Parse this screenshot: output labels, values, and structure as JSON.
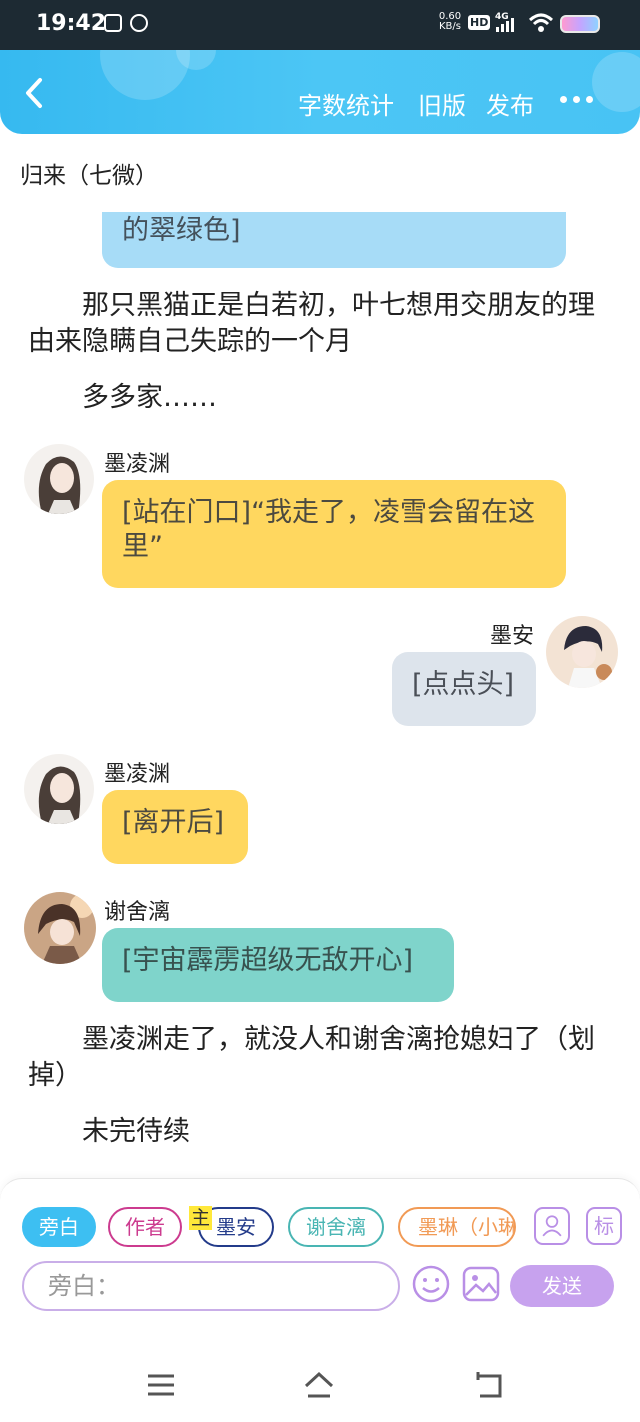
{
  "status": {
    "time": "19:42",
    "net_speed_value": "0.60",
    "net_speed_unit": "KB/s",
    "hd": "HD",
    "network": "4G"
  },
  "header": {
    "word_count": "字数统计",
    "old_version": "旧版",
    "publish": "发布"
  },
  "chapter_title": "归来（七微）",
  "messages": {
    "m1": "的翠绿色]",
    "n1": "那只黑猫正是白若初，叶七想用交朋友的理由来隐瞒自己失踪的一个月",
    "n2": "多多家……",
    "s1": "墨凌渊",
    "m2": "[站在门口]“我走了，凌雪会留在这里”",
    "s2": "墨安",
    "m3": "[点点头]",
    "s3": "墨凌渊",
    "m4": "[离开后]",
    "s4": "谢舍漓",
    "m5": "[宇宙霹雳超级无敌开心]",
    "n3": "墨凌渊走了，就没人和谢舍漓抢媳妇了（划掉）",
    "n4": "未完待续"
  },
  "roles": {
    "narrator": "旁白",
    "author": "作者",
    "main_tag": "主",
    "moan": "墨安",
    "xie": "谢舍漓",
    "molin": "墨琳（小琳"
  },
  "tools": {
    "mark": "标"
  },
  "input": {
    "placeholder": "旁白：",
    "send": "发送"
  },
  "colors": {
    "header": "#3dbff2",
    "bubble_blue": "#a7dcf7",
    "bubble_yellow": "#ffd75f",
    "bubble_gray": "#dde4ec",
    "bubble_teal": "#7fd4cb",
    "send": "#c7a2ee"
  }
}
